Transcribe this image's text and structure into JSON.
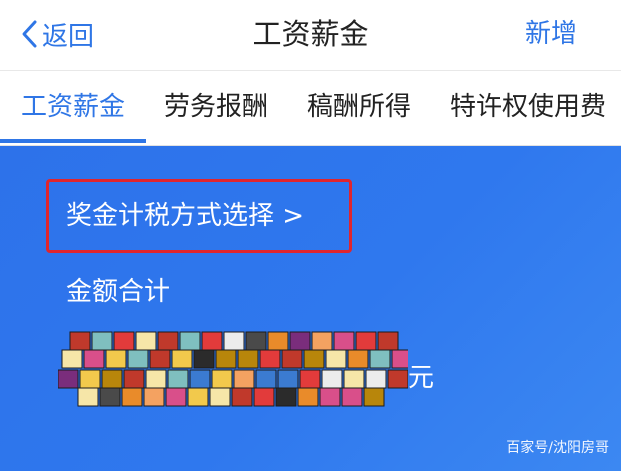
{
  "navbar": {
    "back_label": "返回",
    "title": "工资薪金",
    "action_label": "新增"
  },
  "tabs": [
    {
      "label": "工资薪金",
      "active": true
    },
    {
      "label": "劳务报酬",
      "active": false
    },
    {
      "label": "稿酬所得",
      "active": false
    },
    {
      "label": "特许权使用费",
      "active": false
    }
  ],
  "card": {
    "method_link": "奖金计税方式选择 >",
    "total_label": "金额合计",
    "currency": "元"
  },
  "watermark": "百家号/沈阳房哥",
  "colors": {
    "accent": "#2f76e6",
    "card_bg": "#2f78ee",
    "highlight_box": "#e0252d"
  },
  "icons": {
    "back": "chevron-left-icon"
  }
}
